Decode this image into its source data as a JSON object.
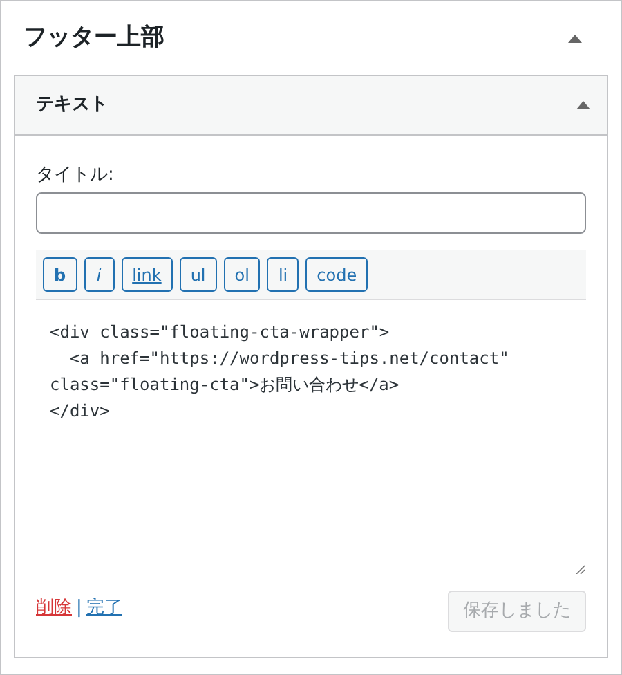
{
  "area": {
    "title": "フッター上部",
    "expanded": true
  },
  "widget": {
    "title": "テキスト",
    "expanded": true
  },
  "title_field": {
    "label": "タイトル:"
  },
  "toolbar": [
    {
      "label": "b",
      "kind": "bold"
    },
    {
      "label": "i",
      "kind": "italic"
    },
    {
      "label": "link",
      "kind": "link"
    },
    {
      "label": "ul",
      "kind": "plain"
    },
    {
      "label": "ol",
      "kind": "plain"
    },
    {
      "label": "li",
      "kind": "plain"
    },
    {
      "label": "code",
      "kind": "plain"
    }
  ],
  "content_lines": [
    "<div class=\"floating-cta-wrapper\">",
    "  <a href=\"https://wordpress-tips.net/contact\"",
    "class=\"floating-cta\">お問い合わせ</a>",
    "</div>"
  ],
  "actions": {
    "delete": "削除",
    "separator": "|",
    "done": "完了"
  },
  "save_button": {
    "label": "保存しました",
    "disabled": true
  }
}
